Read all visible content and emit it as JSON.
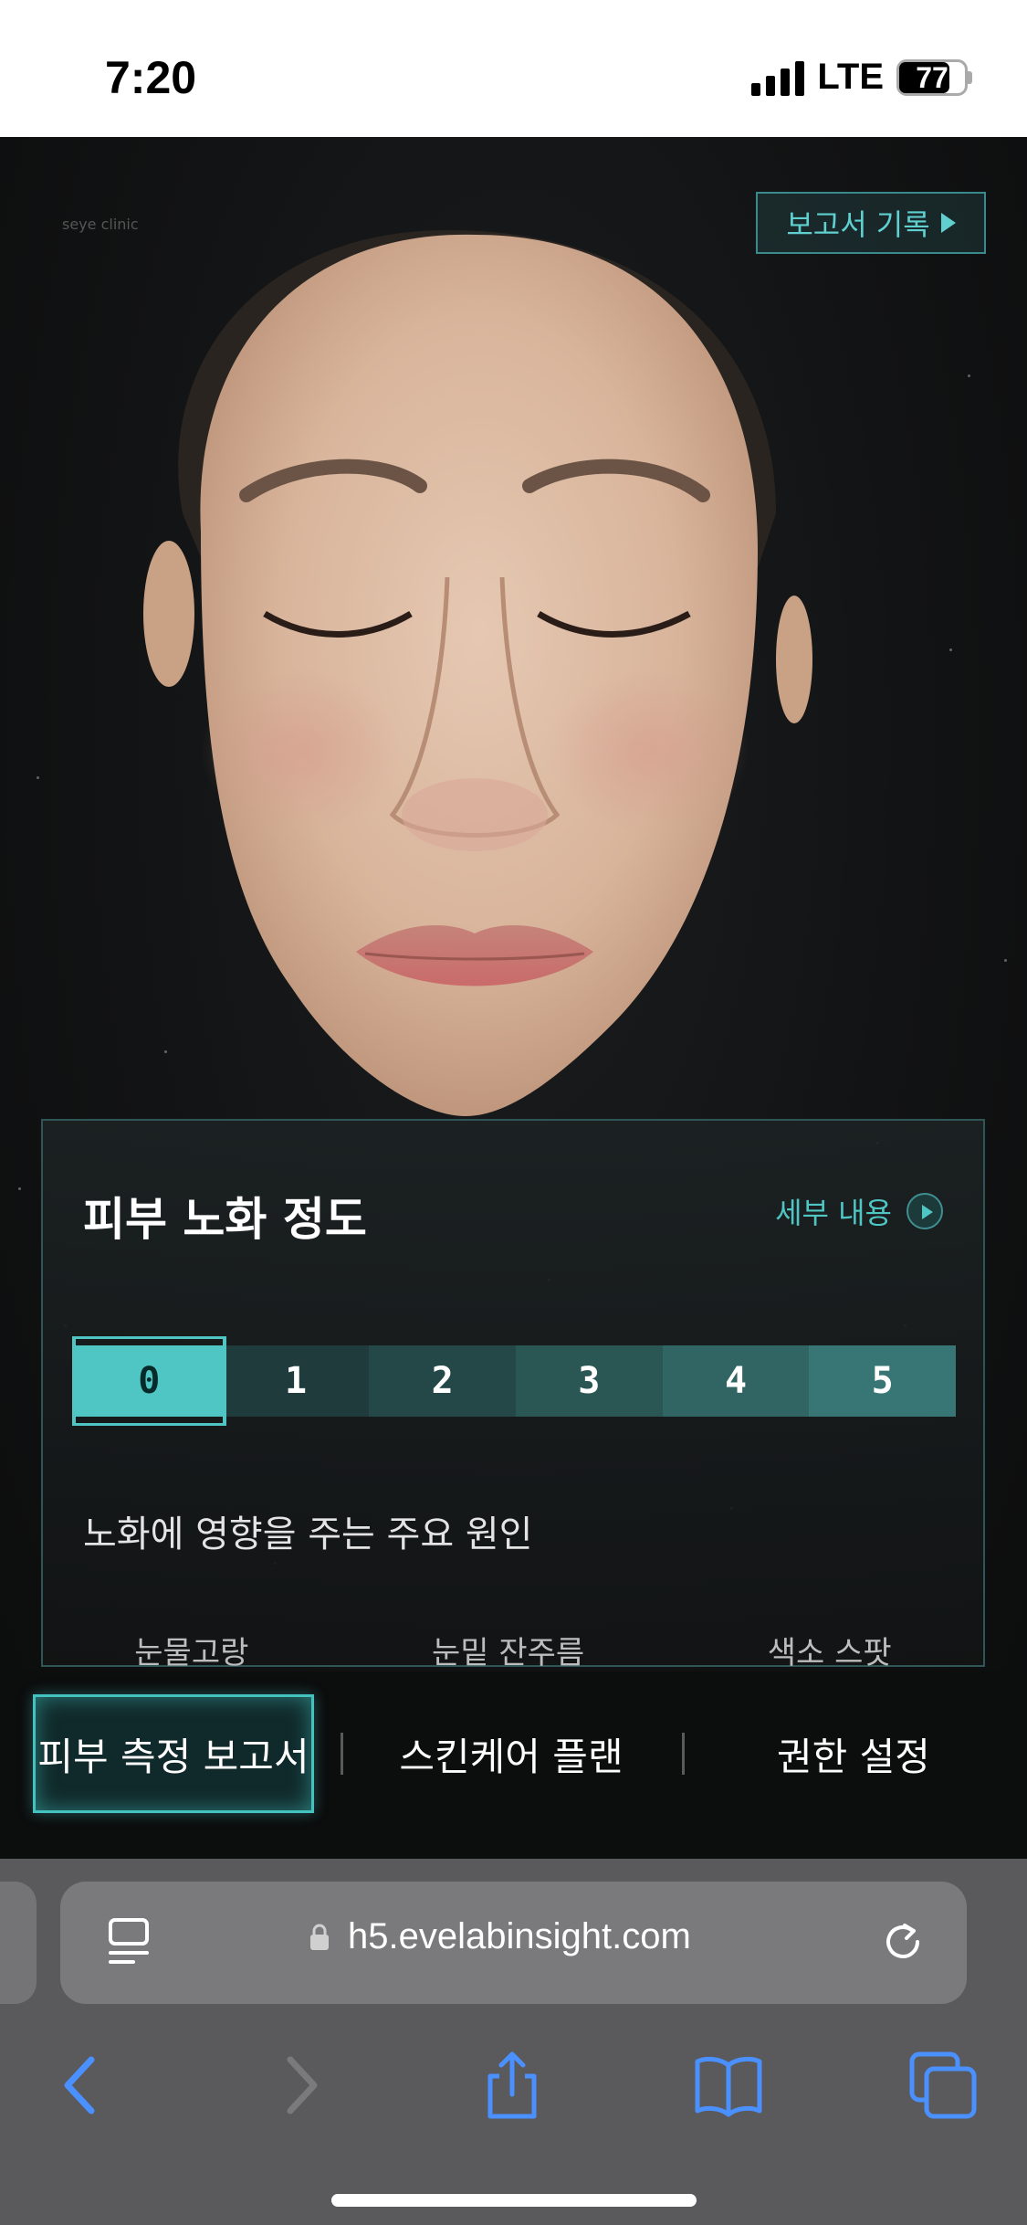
{
  "status_bar": {
    "time": "7:20",
    "network": "LTE",
    "battery": "77",
    "battery_level": 0.77
  },
  "page": {
    "brand": "seye clinic",
    "history_button": "보고서 기록",
    "card": {
      "title": "피부 노화 정도",
      "detail_link": "세부 내용",
      "scale": {
        "levels": [
          "0",
          "1",
          "2",
          "3",
          "4",
          "5"
        ],
        "selected": "0",
        "colors": [
          "#4fc6c4",
          "#1f3b3b",
          "#244747",
          "#2a5654",
          "#306563",
          "#377674"
        ]
      },
      "causes_title": "노화에 영향을 주는 주요 원인",
      "causes": [
        "눈물고랑",
        "눈밑 잔주름",
        "색소 스팟"
      ]
    },
    "tabs": [
      {
        "label": "피부 측정 보고서",
        "active": true
      },
      {
        "label": "스킨케어 플랜",
        "active": false
      },
      {
        "label": "권한 설정",
        "active": false
      }
    ]
  },
  "browser": {
    "url": "h5.evelabinsight.com",
    "icons": [
      "page-menu-icon",
      "lock-icon",
      "reload-icon",
      "back-icon",
      "forward-icon",
      "share-icon",
      "bookmarks-icon",
      "tabs-icon"
    ],
    "accent": "#4a90ff"
  }
}
